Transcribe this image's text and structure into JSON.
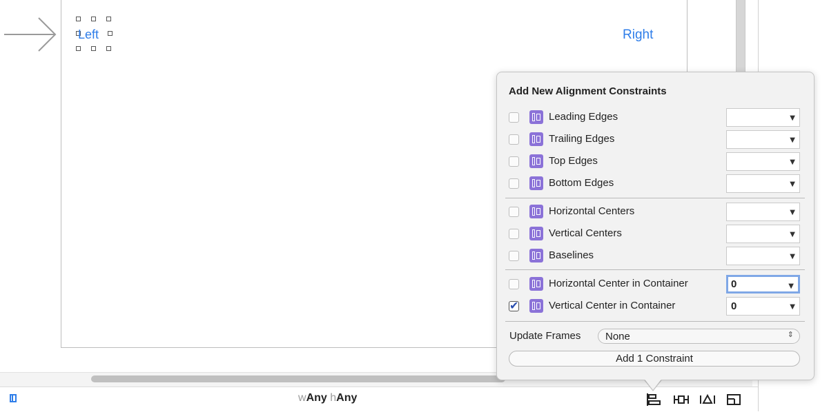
{
  "canvas": {
    "left_label": "Left",
    "right_label": "Right"
  },
  "bottom_bar": {
    "size_class_w_prefix": "w",
    "size_class_w_value": "Any",
    "size_class_h_prefix": "h",
    "size_class_h_value": "Any",
    "tools": [
      "align-icon",
      "pin-icon",
      "resolve-issues-icon",
      "resizing-behavior-icon"
    ]
  },
  "popover": {
    "title": "Add New Alignment Constraints",
    "group1": [
      {
        "label": "Leading Edges",
        "checked": false,
        "value": ""
      },
      {
        "label": "Trailing Edges",
        "checked": false,
        "value": ""
      },
      {
        "label": "Top Edges",
        "checked": false,
        "value": ""
      },
      {
        "label": "Bottom Edges",
        "checked": false,
        "value": ""
      }
    ],
    "group2": [
      {
        "label": "Horizontal Centers",
        "checked": false,
        "value": ""
      },
      {
        "label": "Vertical Centers",
        "checked": false,
        "value": ""
      },
      {
        "label": "Baselines",
        "checked": false,
        "value": ""
      }
    ],
    "group3": [
      {
        "label": "Horizontal Center in Container",
        "checked": false,
        "value": "0"
      },
      {
        "label": "Vertical Center in Container",
        "checked": true,
        "value": "0"
      }
    ],
    "update_frames_label": "Update Frames",
    "update_frames_value": "None",
    "add_button_label": "Add 1 Constraint"
  },
  "colors": {
    "accent": "#2e7de9",
    "icon_purple": "#8b72d8",
    "popover_bg": "#f2f2f2"
  }
}
